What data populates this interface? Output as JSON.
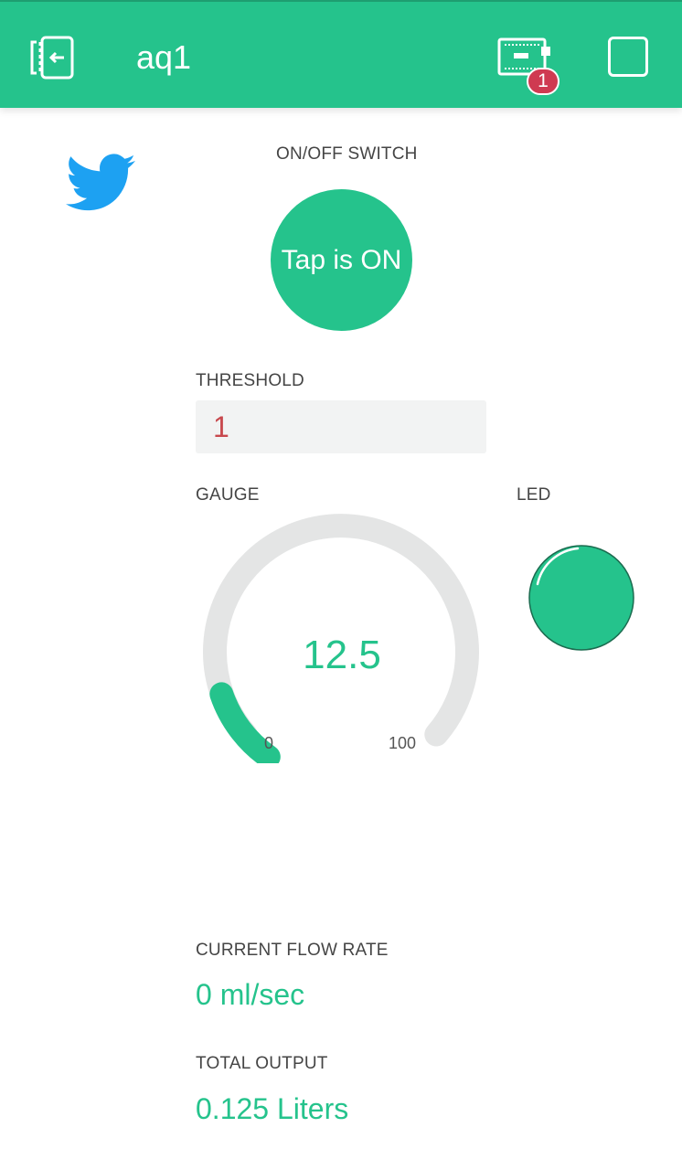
{
  "header": {
    "title": "aq1",
    "back_icon": "exit-icon",
    "device_icon": "device-board-icon",
    "notification_count": "1",
    "accent_color": "#25c38c"
  },
  "twitter": {
    "icon": "twitter-bird-icon",
    "color": "#1da1f2"
  },
  "switch": {
    "label": "ON/OFF SWITCH",
    "state_text": "Tap is ON"
  },
  "threshold": {
    "label": "THRESHOLD",
    "value": "1"
  },
  "gauge": {
    "label": "GAUGE",
    "value": "12.5",
    "min": "0",
    "max": "100",
    "level": 0.125
  },
  "led": {
    "label": "LED",
    "color": "#25c38c"
  },
  "flow_rate": {
    "label": "CURRENT FLOW RATE",
    "value": "0 ml/sec"
  },
  "total_output": {
    "label": "TOTAL OUTPUT",
    "value": "0.125 Liters"
  }
}
